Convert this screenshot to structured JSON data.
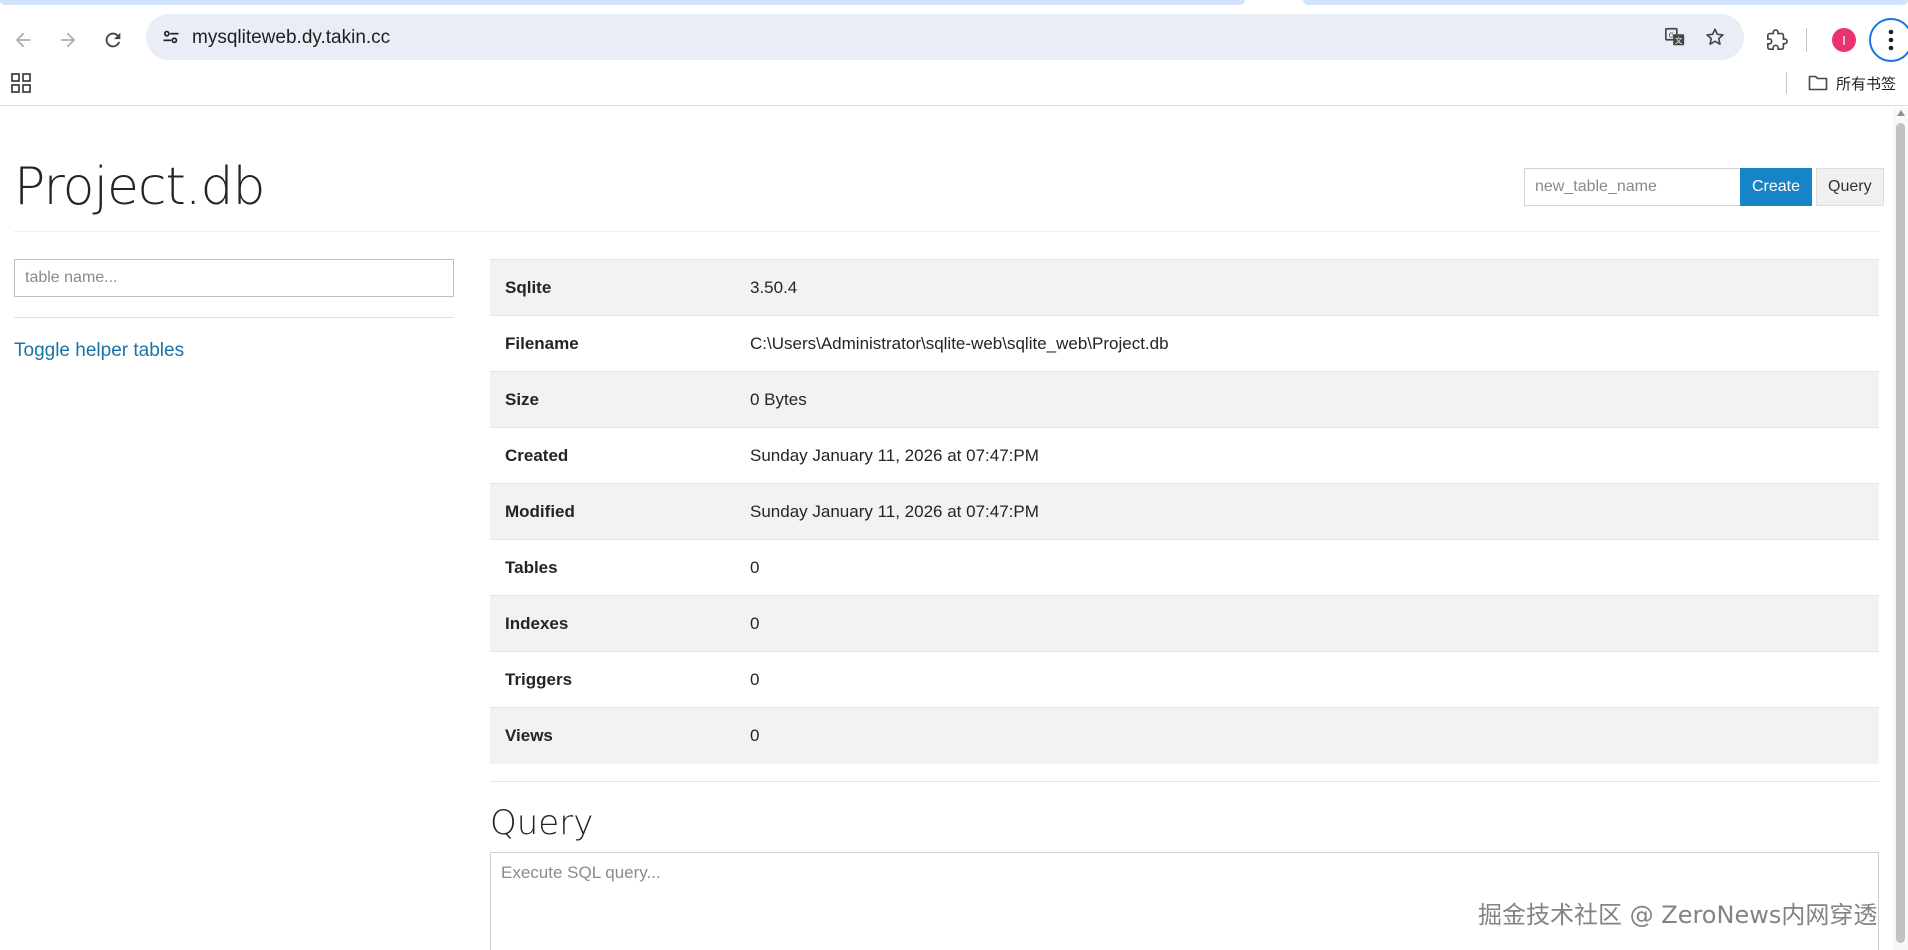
{
  "browser": {
    "url": "mysqliteweb.dy.takin.cc",
    "bookmarks_label": "所有书签",
    "profile_initial": "I"
  },
  "header": {
    "title": "Project.db",
    "new_table_placeholder": "new_table_name",
    "create_label": "Create",
    "query_label": "Query"
  },
  "sidebar": {
    "search_placeholder": "table name...",
    "toggle_label": "Toggle helper tables"
  },
  "info": {
    "rows": [
      {
        "key": "Sqlite",
        "value": "3.50.4"
      },
      {
        "key": "Filename",
        "value": "C:\\Users\\Administrator\\sqlite-web\\sqlite_web\\Project.db"
      },
      {
        "key": "Size",
        "value": "0 Bytes"
      },
      {
        "key": "Created",
        "value": "Sunday January 11, 2026 at 07:47:PM"
      },
      {
        "key": "Modified",
        "value": "Sunday January 11, 2026 at 07:47:PM"
      },
      {
        "key": "Tables",
        "value": "0"
      },
      {
        "key": "Indexes",
        "value": "0"
      },
      {
        "key": "Triggers",
        "value": "0"
      },
      {
        "key": "Views",
        "value": "0"
      }
    ]
  },
  "query": {
    "title": "Query",
    "placeholder": "Execute SQL query..."
  },
  "watermark": "掘金技术社区 @ ZeroNews内网穿透",
  "colors": {
    "accent": "#1784c7",
    "link": "#1a73a8",
    "stripe": "#f2f2f2",
    "omnibox": "#e9eef6"
  }
}
